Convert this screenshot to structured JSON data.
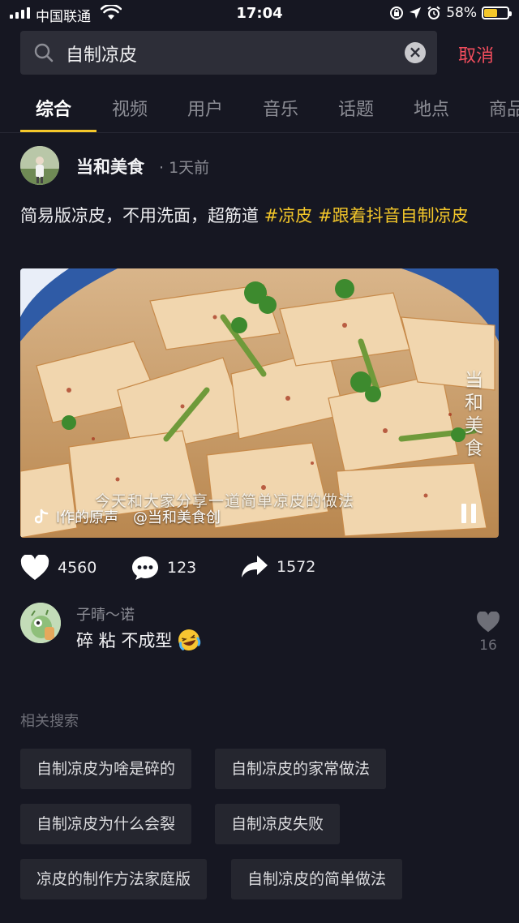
{
  "status_bar": {
    "carrier": "中国联通",
    "time": "17:04",
    "battery_text": "58%",
    "battery_level": 0.58,
    "battery_color": "#f4c72a"
  },
  "search": {
    "query": "自制凉皮",
    "cancel_label": "取消"
  },
  "tabs": [
    "综合",
    "视频",
    "用户",
    "音乐",
    "话题",
    "地点",
    "商品"
  ],
  "post": {
    "author": "当和美食",
    "time": "· 1天前",
    "caption_text": "简易版凉皮，不用洗面，超筋道",
    "hashtag_1": "#凉皮",
    "hashtag_2": "#跟着抖音自制凉皮",
    "video": {
      "overlay_text": "今天和大家分享一道简单凉皮的做法",
      "watermark": "当和美食",
      "music": "l作的原声　@当和美食创"
    },
    "likes": "4560",
    "comments": "123",
    "shares": "1572"
  },
  "comment": {
    "user": "子晴～诺",
    "text": "碎 粘 不成型",
    "like_count": "16"
  },
  "related": {
    "title": "相关搜索",
    "items": [
      "自制凉皮为啥是碎的",
      "自制凉皮的家常做法",
      "自制凉皮为什么会裂",
      "自制凉皮失败",
      "凉皮的制作方法家庭版",
      "自制凉皮的简单做法"
    ]
  },
  "colors": {
    "background": "#161722",
    "accent": "#f4c72a",
    "cancel": "#f24d5d"
  }
}
